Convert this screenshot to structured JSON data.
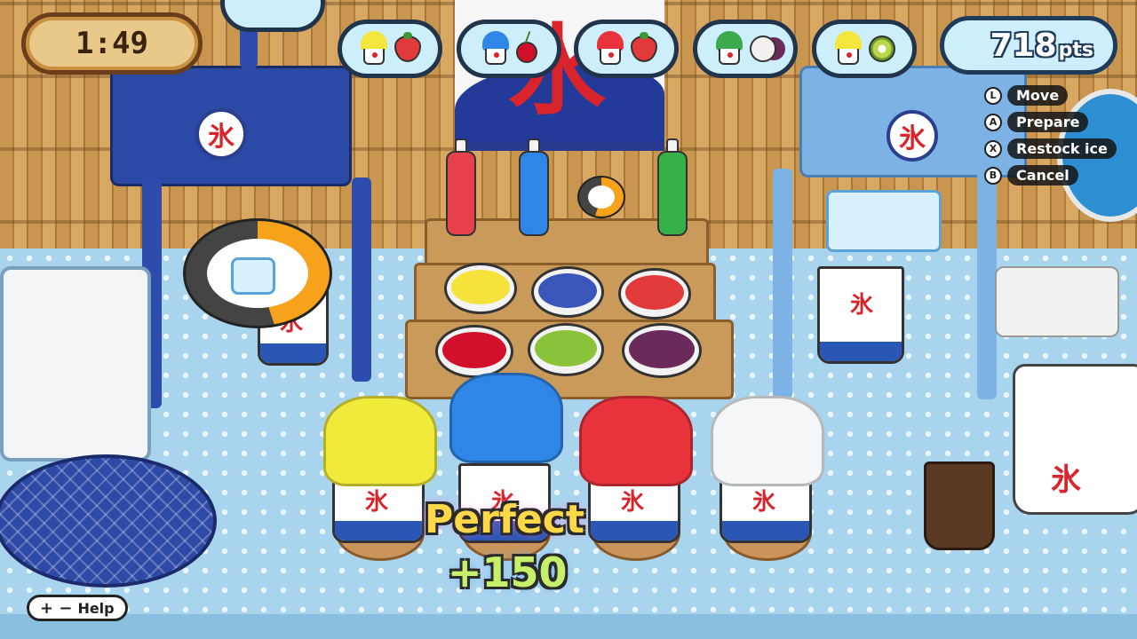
{
  "hud": {
    "timer": "1:49",
    "score_value": "718",
    "score_unit": "pts"
  },
  "orders": [
    {
      "syrup_color": "#f4e63a",
      "topping": "strawberry"
    },
    {
      "syrup_color": "#2f86e6",
      "topping": "cherry"
    },
    {
      "syrup_color": "#e8333d",
      "topping": "strawberry"
    },
    {
      "syrup_color": "#3aaa4a",
      "topping": "lychee"
    },
    {
      "syrup_color": "#f4e63a",
      "topping": "kiwi"
    }
  ],
  "controls": [
    {
      "button": "L",
      "label": "Move"
    },
    {
      "button": "A",
      "label": "Prepare"
    },
    {
      "button": "X",
      "label": "Restock ice"
    },
    {
      "button": "B",
      "label": "Cancel"
    }
  ],
  "help": {
    "symbol": "+ −",
    "label": "Help"
  },
  "feedback": {
    "rating": "Perfect",
    "bonus": "+150"
  },
  "kanji": "氷",
  "syrups": [
    {
      "name": "strawberry-syrup",
      "color": "#e8404a"
    },
    {
      "name": "blue-hawaii-syrup",
      "color": "#2f86e6"
    },
    {
      "name": "melon-syrup",
      "color": "#38b04a"
    }
  ],
  "toppings": [
    {
      "name": "lemon",
      "color": "#f5e33c"
    },
    {
      "name": "blueberry",
      "color": "#3a56b8"
    },
    {
      "name": "strawberry",
      "color": "#e23a3a"
    },
    {
      "name": "cherry",
      "color": "#d3102a"
    },
    {
      "name": "kiwi",
      "color": "#8ac23a"
    },
    {
      "name": "lychee",
      "color": "#f3eeee"
    }
  ],
  "served_cups": [
    {
      "syrup_color": "#f0ea3a"
    },
    {
      "syrup_color": "#2f86e6"
    },
    {
      "syrup_color": "#e8333d"
    },
    {
      "syrup_color": "#f4f6f8"
    }
  ]
}
